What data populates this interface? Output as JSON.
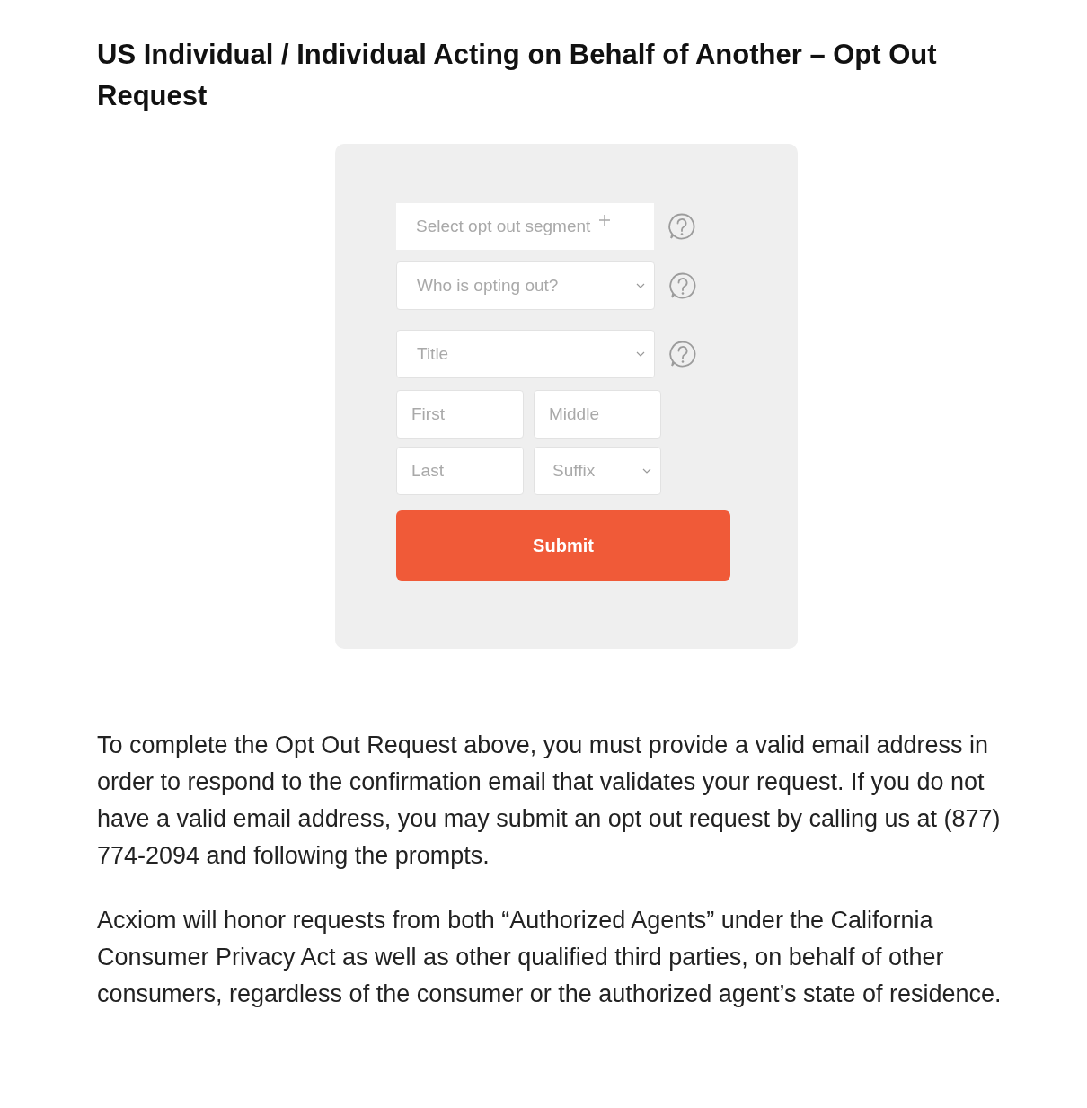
{
  "heading": "US Individual / Individual Acting on Behalf of Another – Opt Out Request",
  "form": {
    "rows": [
      [
        {
          "kind": "picker",
          "placeholder": "Select opt out segment",
          "help": true
        }
      ],
      [
        {
          "kind": "select",
          "placeholder": "Who is opting out?",
          "help": true
        }
      ],
      [
        {
          "kind": "select",
          "placeholder": "Title",
          "help": true
        }
      ],
      [
        {
          "kind": "input",
          "placeholder": "First",
          "help": false
        },
        {
          "kind": "input",
          "placeholder": "Middle",
          "help": false
        }
      ],
      [
        {
          "kind": "input",
          "placeholder": "Last",
          "help": false
        },
        {
          "kind": "select",
          "placeholder": "Suffix",
          "help": false
        }
      ]
    ],
    "submit": "Submit"
  },
  "paragraphs": [
    "To complete the Opt Out Request above, you must provide a valid email address in order to respond to the confirmation email that validates your request. If you do not have a valid email address, you may submit an opt out request by calling us at (877) 774-2094 and following the prompts.",
    "Acxiom will honor requests from both “Authorized Agents” under the California Consumer Privacy Act as well as other qualified third parties, on behalf of other consumers, regardless of the consumer or the authorized agent’s state of residence."
  ]
}
